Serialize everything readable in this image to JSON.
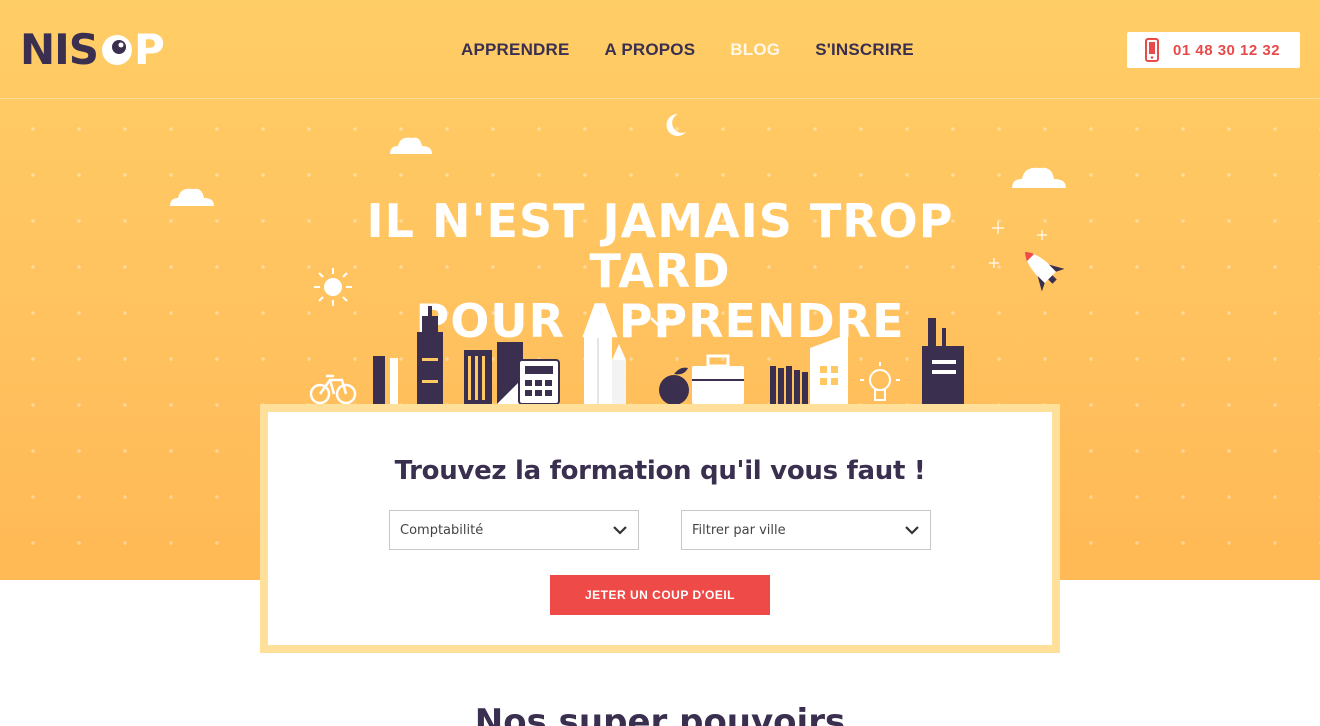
{
  "brand": {
    "logo_text_left": "NIS",
    "logo_text_right": "P"
  },
  "nav": {
    "items": [
      {
        "label": "APPRENDRE"
      },
      {
        "label": "A PROPOS"
      },
      {
        "label": "BLOG"
      },
      {
        "label": "S'INSCRIRE"
      }
    ],
    "active_index": 2
  },
  "phone": {
    "number": "01 48 30 12 32",
    "icon": "phone-icon"
  },
  "hero": {
    "headline_line1": "IL N'EST JAMAIS TROP TARD",
    "headline_line2": "POUR APPRENDRE"
  },
  "search": {
    "title": "Trouvez la formation qu'il vous faut !",
    "category_value": "Comptabilité",
    "city_placeholder": "Filtrer par ville",
    "submit_label": "JETER UN COUP D'OEIL"
  },
  "next_section": {
    "title": "Nos super pouvoirs"
  },
  "colors": {
    "hero_bg": "#ffc862",
    "dark": "#3a2f4f",
    "accent_red": "#ee4a48",
    "frame": "#ffe09b"
  }
}
